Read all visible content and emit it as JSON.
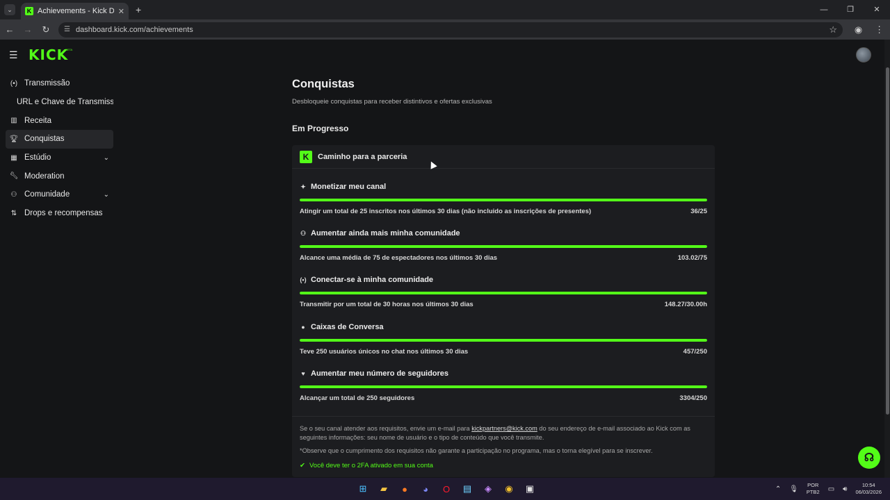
{
  "browser": {
    "tab_title": "Achievements - Kick Dashboard",
    "tab_menu_icon": "chevron-down-icon",
    "url": "dashboard.kick.com/achievements"
  },
  "header": {
    "logo": "KICK",
    "beta": "BETA"
  },
  "sidebar": {
    "items": [
      {
        "label": "Transmissão",
        "icon": "broadcast-icon"
      },
      {
        "label": "URL e Chave de Transmissão",
        "icon": ""
      },
      {
        "label": "Receita",
        "icon": "chart-icon"
      },
      {
        "label": "Conquistas",
        "icon": "trophy-icon",
        "active": true
      },
      {
        "label": "Estúdio",
        "icon": "studio-icon",
        "expandable": true
      },
      {
        "label": "Moderation",
        "icon": "wrench-icon"
      },
      {
        "label": "Comunidade",
        "icon": "community-icon",
        "expandable": true
      },
      {
        "label": "Drops e recompensas",
        "icon": "gift-icon"
      }
    ]
  },
  "main": {
    "title": "Conquistas",
    "subtitle": "Desbloqueie conquistas para receber distintivos e ofertas exclusivas",
    "section": "Em Progresso",
    "card": {
      "title": "Caminho para a parceria",
      "badge": "K",
      "goals": [
        {
          "title": "Monetizar meu canal",
          "icon": "sparkle-icon",
          "desc": "Atingir um total de 25 inscritos nos últimos 30 dias (não incluido as inscrições de presentes)",
          "value": "36/25",
          "progress": 100
        },
        {
          "title": "Aumentar ainda mais minha comunidade",
          "icon": "users-icon",
          "desc": "Alcance uma média de 75 de espectadores nos últimos 30 dias",
          "value": "103.02/75",
          "progress": 100
        },
        {
          "title": "Conectar-se à minha comunidade",
          "icon": "broadcast-icon",
          "desc": "Transmitir por um total de 30 horas nos últimos 30 dias",
          "value": "148.27/30.00h",
          "progress": 100
        },
        {
          "title": "Caixas de Conversa",
          "icon": "chat-icon",
          "desc": "Teve 250 usuários únicos no chat nos últimos 30 dias",
          "value": "457/250",
          "progress": 100
        },
        {
          "title": "Aumentar meu número de seguidores",
          "icon": "heart-icon",
          "desc": "Alcançar um total de 250 seguidores",
          "value": "3304/250",
          "progress": 100
        }
      ],
      "footer": {
        "text_before": "Se o seu canal atender aos requisitos, envie um e-mail para ",
        "email": "kickpartners@kick.com",
        "text_after": " do seu endereço de e-mail associado ao Kick com as seguintes informações: seu nome de usuário e o tipo de conteúdo que você transmite.",
        "note": "*Observe que o cumprimento dos requisitos não garante a participação no programa, mas o torna elegível para se inscrever.",
        "twofa": "Você deve ter o 2FA ativado em sua conta"
      }
    }
  },
  "taskbar": {
    "lang_line1": "POR",
    "lang_line2": "PTB2",
    "time": "10:54",
    "date": "06/03/2026"
  },
  "colors": {
    "accent": "#53fc18",
    "background": "#141517",
    "card": "#1c1d20"
  }
}
